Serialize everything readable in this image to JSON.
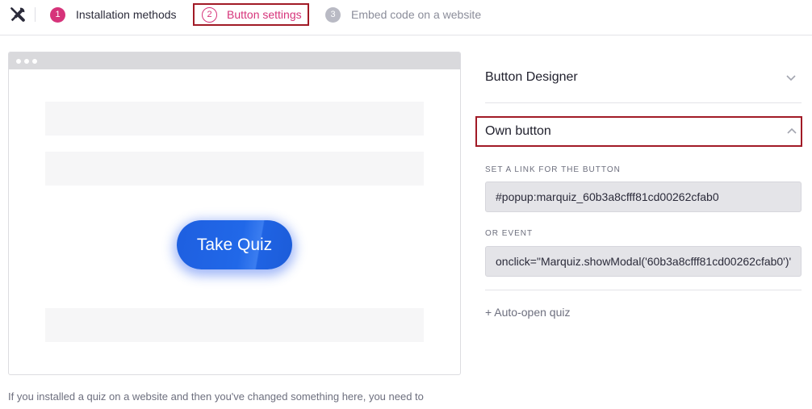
{
  "header": {
    "steps": [
      {
        "number": "1",
        "label": "Installation methods"
      },
      {
        "number": "2",
        "label": "Button settings"
      },
      {
        "number": "3",
        "label": "Embed code on a website"
      }
    ]
  },
  "preview": {
    "button_label": "Take Quiz",
    "button_color": "#1e5fe0"
  },
  "footnote": "If you installed a quiz on a website and then you've changed something here, you need to",
  "panel": {
    "designer_title": "Button Designer",
    "own_button_title": "Own button",
    "link_label": "SET A LINK FOR THE BUTTON",
    "link_value": "#popup:marquiz_60b3a8cfff81cd00262cfab0",
    "event_label": "OR EVENT",
    "event_value": "onclick=\"Marquiz.showModal('60b3a8cfff81cd00262cfab0')'",
    "auto_open_label": "+ Auto-open quiz"
  },
  "icons": {
    "tools": "tools-icon",
    "collapse": "chevron-down-icon",
    "expand": "chevron-up-icon"
  },
  "colors": {
    "accent": "#d6337a",
    "highlight_border": "#a11a26"
  }
}
